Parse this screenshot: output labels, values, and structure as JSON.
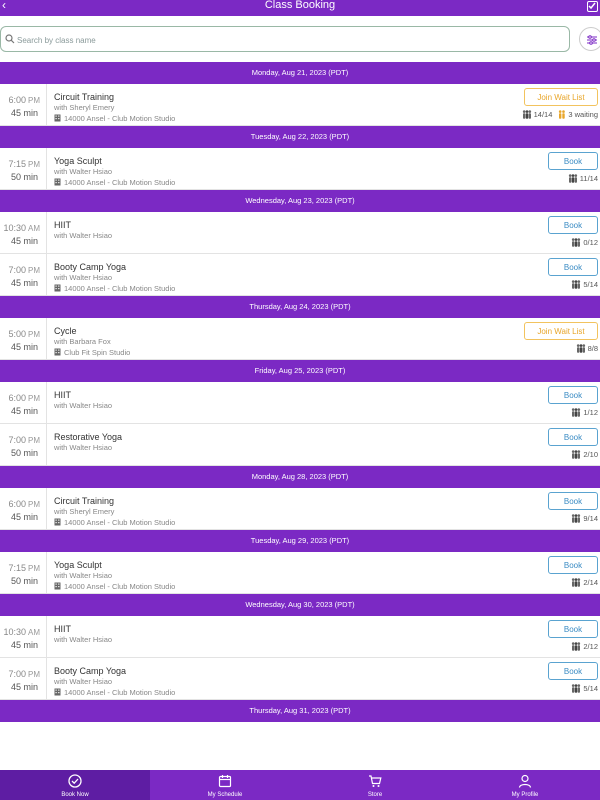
{
  "header": {
    "title": "Class Booking",
    "back_icon": "chevron-left-icon",
    "right_icon": "checkbox-icon"
  },
  "search": {
    "placeholder": "Search by class name",
    "value": ""
  },
  "colors": {
    "brand": "#7b29c4",
    "book": "#3b8cc4",
    "waitlist": "#e8a62a"
  },
  "days": [
    {
      "date": "Monday, Aug 21, 2023 (PDT)",
      "classes": [
        {
          "time": "6:00",
          "ampm": "PM",
          "duration": "45 min",
          "name": "Circuit Training",
          "instructor": "with Sheryl Emery",
          "location": "14000 Ansel - Club Motion Studio",
          "action": "Join Wait List",
          "action_type": "wait",
          "capacity": "14/14",
          "waiting": "3 waiting"
        }
      ]
    },
    {
      "date": "Tuesday, Aug 22, 2023 (PDT)",
      "classes": [
        {
          "time": "7:15",
          "ampm": "PM",
          "duration": "50 min",
          "name": "Yoga Sculpt",
          "instructor": "with Walter Hsiao",
          "location": "14000 Ansel - Club Motion Studio",
          "action": "Book",
          "action_type": "book",
          "capacity": "11/14"
        }
      ]
    },
    {
      "date": "Wednesday, Aug 23, 2023 (PDT)",
      "classes": [
        {
          "time": "10:30",
          "ampm": "AM",
          "duration": "45 min",
          "name": "HIIT",
          "instructor": "with Walter Hsiao",
          "action": "Book",
          "action_type": "book",
          "capacity": "0/12"
        },
        {
          "time": "7:00",
          "ampm": "PM",
          "duration": "45 min",
          "name": "Booty Camp Yoga",
          "instructor": "with Walter Hsiao",
          "location": "14000 Ansel - Club Motion Studio",
          "action": "Book",
          "action_type": "book",
          "capacity": "5/14"
        }
      ]
    },
    {
      "date": "Thursday, Aug 24, 2023 (PDT)",
      "classes": [
        {
          "time": "5:00",
          "ampm": "PM",
          "duration": "45 min",
          "name": "Cycle",
          "instructor": "with Barbara Fox",
          "location": "Club Fit Spin Studio",
          "action": "Join Wait List",
          "action_type": "wait",
          "capacity": "8/8"
        }
      ]
    },
    {
      "date": "Friday, Aug 25, 2023 (PDT)",
      "classes": [
        {
          "time": "6:00",
          "ampm": "PM",
          "duration": "45 min",
          "name": "HIIT",
          "instructor": "with Walter Hsiao",
          "action": "Book",
          "action_type": "book",
          "capacity": "1/12"
        },
        {
          "time": "7:00",
          "ampm": "PM",
          "duration": "50 min",
          "name": "Restorative Yoga",
          "instructor": "with Walter Hsiao",
          "action": "Book",
          "action_type": "book",
          "capacity": "2/10"
        }
      ]
    },
    {
      "date": "Monday, Aug 28, 2023 (PDT)",
      "classes": [
        {
          "time": "6:00",
          "ampm": "PM",
          "duration": "45 min",
          "name": "Circuit Training",
          "instructor": "with Sheryl Emery",
          "location": "14000 Ansel - Club Motion Studio",
          "action": "Book",
          "action_type": "book",
          "capacity": "9/14"
        }
      ]
    },
    {
      "date": "Tuesday, Aug 29, 2023 (PDT)",
      "classes": [
        {
          "time": "7:15",
          "ampm": "PM",
          "duration": "50 min",
          "name": "Yoga Sculpt",
          "instructor": "with Walter Hsiao",
          "location": "14000 Ansel - Club Motion Studio",
          "action": "Book",
          "action_type": "book",
          "capacity": "2/14"
        }
      ]
    },
    {
      "date": "Wednesday, Aug 30, 2023 (PDT)",
      "classes": [
        {
          "time": "10:30",
          "ampm": "AM",
          "duration": "45 min",
          "name": "HIIT",
          "instructor": "with Walter Hsiao",
          "action": "Book",
          "action_type": "book",
          "capacity": "2/12"
        },
        {
          "time": "7:00",
          "ampm": "PM",
          "duration": "45 min",
          "name": "Booty Camp Yoga",
          "instructor": "with Walter Hsiao",
          "location": "14000 Ansel - Club Motion Studio",
          "action": "Book",
          "action_type": "book",
          "capacity": "5/14"
        }
      ]
    },
    {
      "date": "Thursday, Aug 31, 2023 (PDT)",
      "classes": []
    }
  ],
  "tabs": [
    {
      "label": "Book Now",
      "icon": "check-circle-icon",
      "active": true
    },
    {
      "label": "My Schedule",
      "icon": "calendar-icon",
      "active": false
    },
    {
      "label": "Store",
      "icon": "cart-icon",
      "active": false
    },
    {
      "label": "My Profile",
      "icon": "user-icon",
      "active": false
    }
  ]
}
